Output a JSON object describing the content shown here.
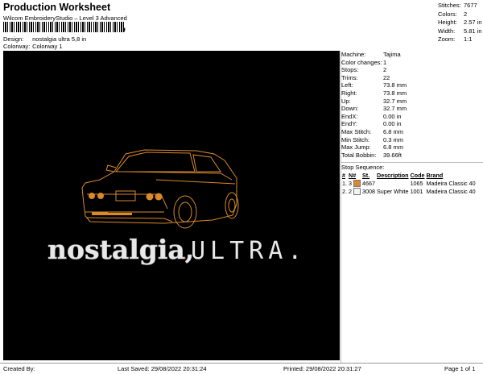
{
  "header": {
    "title": "Production Worksheet",
    "subtitle": "Wilcom EmbroideryStudio – Level 3 Advanced",
    "design_label": "Design:",
    "design_value": "nostalgia ultra 5,8 in",
    "colorway_label": "Colorway:",
    "colorway_value": "Colorway 1"
  },
  "stats": [
    {
      "k": "Stitches:",
      "v": "7677"
    },
    {
      "k": "Colors:",
      "v": "2"
    },
    {
      "k": "Height:",
      "v": "2.57 in"
    },
    {
      "k": "Width:",
      "v": "5.81 in"
    },
    {
      "k": "Zoom:",
      "v": "1:1"
    }
  ],
  "specs": [
    {
      "k": "Machine:",
      "v": "Tajima"
    },
    {
      "k": "Color changes:",
      "v": "1"
    },
    {
      "k": "Stops:",
      "v": "2"
    },
    {
      "k": "Trims:",
      "v": "22"
    },
    {
      "k": "Left:",
      "v": "73.8 mm"
    },
    {
      "k": "Right:",
      "v": "73.8 mm"
    },
    {
      "k": "Up:",
      "v": "32.7 mm"
    },
    {
      "k": "Down:",
      "v": "32.7 mm"
    },
    {
      "k": "EndX:",
      "v": "0.00 in"
    },
    {
      "k": "EndY:",
      "v": "0.00 in"
    },
    {
      "k": "Max Stitch:",
      "v": "6.8 mm"
    },
    {
      "k": "Min Stitch:",
      "v": "0.3 mm"
    },
    {
      "k": "Max Jump:",
      "v": "6.8 mm"
    },
    {
      "k": "Total Bobbin:",
      "v": "39.66ft"
    }
  ],
  "sequence": {
    "title": "Stop Sequence:",
    "headers": [
      "#",
      "N#",
      "St.",
      "Description",
      "Code",
      "Brand"
    ],
    "rows": [
      {
        "num": "1.",
        "n": "3",
        "swatch": "#d98a2b",
        "st": "4667",
        "desc": "",
        "code": "1065",
        "brand": "Madeira Classic 40"
      },
      {
        "num": "2.",
        "n": "2",
        "swatch": "#f4f4f4",
        "st": "3008",
        "desc": "Super White",
        "code": "1001",
        "brand": "Madeira Classic 40"
      }
    ]
  },
  "design": {
    "text_main": "nostalgia,",
    "text_caps": "ULTRA."
  },
  "footer": {
    "created": "Created By:",
    "saved": "Last Saved: 29/08/2022 20:31:24",
    "printed": "Printed: 29/08/2022 20:31:27",
    "page": "Page 1 of 1"
  },
  "colors": {
    "orange": "#d98a2b",
    "white": "#e8e8e8"
  }
}
